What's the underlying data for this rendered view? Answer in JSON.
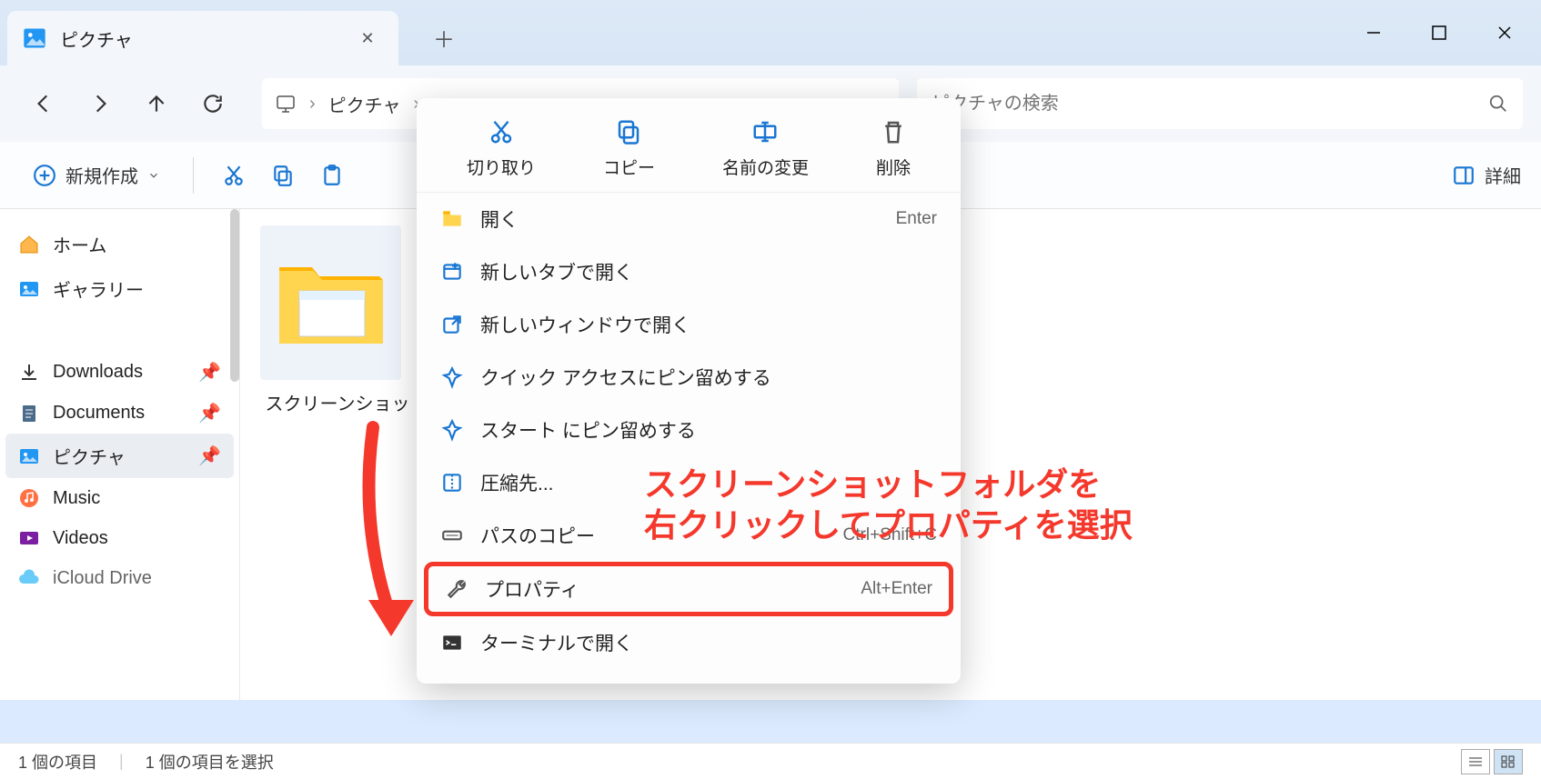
{
  "tab": {
    "title": "ピクチャ"
  },
  "breadcrumb": {
    "current": "ピクチャ"
  },
  "search": {
    "placeholder": "ピクチャの検索"
  },
  "toolbar": {
    "new_label": "新規作成",
    "details_label": "詳細"
  },
  "sidebar": {
    "home": "ホーム",
    "gallery": "ギャラリー",
    "items": [
      {
        "label": "Downloads"
      },
      {
        "label": "Documents"
      },
      {
        "label": "ピクチャ"
      },
      {
        "label": "Music"
      },
      {
        "label": "Videos"
      },
      {
        "label": "iCloud Drive"
      }
    ]
  },
  "folder": {
    "name": "スクリーンショッ"
  },
  "ctx": {
    "top": {
      "cut": "切り取り",
      "copy": "コピー",
      "rename": "名前の変更",
      "delete": "削除"
    },
    "items": {
      "open": "開く",
      "open_key": "Enter",
      "newtab": "新しいタブで開く",
      "newwin": "新しいウィンドウで開く",
      "pin_quick": "クイック アクセスにピン留めする",
      "pin_start": "スタート にピン留めする",
      "compress": "圧縮先...",
      "copy_path": "パスのコピー",
      "copy_path_key": "Ctrl+Shift+C",
      "properties": "プロパティ",
      "properties_key": "Alt+Enter",
      "terminal": "ターミナルで開く"
    }
  },
  "status": {
    "count": "1 個の項目",
    "selected": "1 個の項目を選択"
  },
  "annotation": {
    "line1": "スクリーンショットフォルダを",
    "line2": "右クリックしてプロパティを選択"
  }
}
